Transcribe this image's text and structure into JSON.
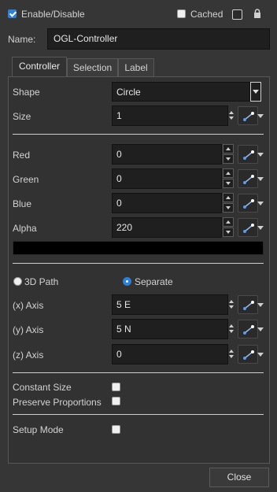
{
  "header": {
    "enable_label": "Enable/Disable",
    "enable_checked": true,
    "cached_label": "Cached",
    "cached_checked": false
  },
  "name": {
    "label": "Name:",
    "value": "OGL-Controller"
  },
  "tabs": [
    {
      "label": "Controller",
      "active": true
    },
    {
      "label": "Selection",
      "active": false
    },
    {
      "label": "Label",
      "active": false
    }
  ],
  "shape": {
    "label": "Shape",
    "value": "Circle"
  },
  "size": {
    "label": "Size",
    "value": "1"
  },
  "color": {
    "red": {
      "label": "Red",
      "value": "0"
    },
    "green": {
      "label": "Green",
      "value": "0"
    },
    "blue": {
      "label": "Blue",
      "value": "0"
    },
    "alpha": {
      "label": "Alpha",
      "value": "220"
    },
    "swatch": "#000000"
  },
  "path_mode": {
    "option_3d": "3D Path",
    "option_separate": "Separate",
    "selected": "separate"
  },
  "axes": {
    "x": {
      "label": "(x) Axis",
      "value": "5 E"
    },
    "y": {
      "label": "(y) Axis",
      "value": "5 N"
    },
    "z": {
      "label": "(z) Axis",
      "value": "0"
    }
  },
  "options": {
    "constant_size": {
      "label": "Constant Size",
      "checked": false
    },
    "preserve_proportions": {
      "label": "Preserve Proportions",
      "checked": false
    },
    "setup_mode": {
      "label": "Setup Mode",
      "checked": false
    }
  },
  "footer": {
    "close_label": "Close"
  },
  "icons": {
    "function": "link-function-icon",
    "lock": "lock-icon"
  },
  "colors": {
    "accent": "#2f7fd6",
    "background": "#363636",
    "field": "#1f1f1f"
  }
}
